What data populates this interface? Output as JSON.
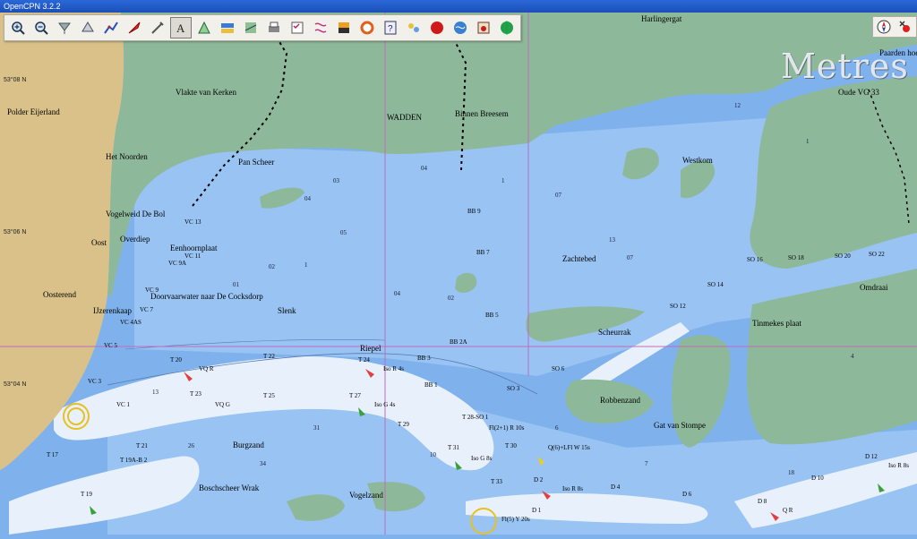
{
  "window": {
    "title": "OpenCPN 3.2.2"
  },
  "toolbar": {
    "buttons": [
      {
        "icon": "zoom-in-icon"
      },
      {
        "icon": "zoom-out-icon"
      },
      {
        "icon": "scale-in-icon"
      },
      {
        "icon": "scale-out-icon"
      },
      {
        "icon": "route-icon"
      },
      {
        "icon": "auto-follow-icon"
      },
      {
        "icon": "settings-icon"
      },
      {
        "icon": "text-icon",
        "active": true
      },
      {
        "icon": "ais-icon"
      },
      {
        "icon": "quilt-icon"
      },
      {
        "icon": "chart-panel-icon"
      },
      {
        "icon": "print-icon"
      },
      {
        "icon": "route-manager-icon"
      },
      {
        "icon": "track-icon"
      },
      {
        "icon": "color-scheme-icon"
      },
      {
        "icon": "mob-icon"
      },
      {
        "icon": "help-icon"
      },
      {
        "icon": "tides-icon"
      },
      {
        "icon": "record-icon"
      },
      {
        "icon": "world-icon"
      },
      {
        "icon": "chart-download-icon"
      },
      {
        "icon": "globe-icon"
      }
    ]
  },
  "overlay": {
    "units": "Metres"
  },
  "latitudes": [
    "53°08 N",
    "53°06 N",
    "53°04 N"
  ],
  "places": [
    {
      "text": "Harlingergat"
    },
    {
      "text": "Polder Eijerland"
    },
    {
      "text": "Vlakte van Kerken"
    },
    {
      "text": "WADDEN"
    },
    {
      "text": "Binnen Breesem"
    },
    {
      "text": "Het Noorden"
    },
    {
      "text": "Pan Scheer"
    },
    {
      "text": "Vogelweid De Bol"
    },
    {
      "text": "Oost"
    },
    {
      "text": "Overdiep"
    },
    {
      "text": "Eenhoornplaat"
    },
    {
      "text": "Oosterend"
    },
    {
      "text": "IJzerenkaap"
    },
    {
      "text": "Slenk"
    },
    {
      "text": "Zachtebed"
    },
    {
      "text": "Westkom"
    },
    {
      "text": "Oude VG 33"
    },
    {
      "text": "Paarden hoek"
    },
    {
      "text": "Omdraai"
    },
    {
      "text": "Tinmekes plaat"
    },
    {
      "text": "Scheurrak"
    },
    {
      "text": "Robbenzand"
    },
    {
      "text": "Gat van Stompe"
    },
    {
      "text": "Burgzand"
    },
    {
      "text": "Boschscheer Wrak"
    },
    {
      "text": "Vogelzand"
    },
    {
      "text": "Riepel"
    },
    {
      "text": "Doorvaarwater naar De Cocksdorp"
    }
  ],
  "buoys": [
    {
      "text": "VC 13"
    },
    {
      "text": "VC 11"
    },
    {
      "text": "VC 9A"
    },
    {
      "text": "VC 9"
    },
    {
      "text": "VC 7"
    },
    {
      "text": "VC 5"
    },
    {
      "text": "VC 3"
    },
    {
      "text": "VC 1"
    },
    {
      "text": "VC 4AS"
    },
    {
      "text": "BB 9"
    },
    {
      "text": "BB 7"
    },
    {
      "text": "BB 5"
    },
    {
      "text": "BB 3"
    },
    {
      "text": "BB 1"
    },
    {
      "text": "BB 2A"
    },
    {
      "text": "T 20"
    },
    {
      "text": "T 22"
    },
    {
      "text": "T 24"
    },
    {
      "text": "T 23"
    },
    {
      "text": "T 25"
    },
    {
      "text": "T 27"
    },
    {
      "text": "T 29"
    },
    {
      "text": "T 28-SO 1"
    },
    {
      "text": "T 31"
    },
    {
      "text": "T 30"
    },
    {
      "text": "T 33"
    },
    {
      "text": "T 21"
    },
    {
      "text": "T 19A-B 2"
    },
    {
      "text": "T 19"
    },
    {
      "text": "T 17"
    },
    {
      "text": "SO 16"
    },
    {
      "text": "SO 18"
    },
    {
      "text": "SO 20"
    },
    {
      "text": "SO 22"
    },
    {
      "text": "SO 14"
    },
    {
      "text": "SO 12"
    },
    {
      "text": "SO 6"
    },
    {
      "text": "SO 3"
    },
    {
      "text": "D 1"
    },
    {
      "text": "D 2"
    },
    {
      "text": "D 4"
    },
    {
      "text": "D 6"
    },
    {
      "text": "D 8"
    },
    {
      "text": "D 10"
    },
    {
      "text": "D 12"
    },
    {
      "text": "Iso R 4s"
    },
    {
      "text": "Iso G 4s"
    },
    {
      "text": "VQ G"
    },
    {
      "text": "VQ R"
    },
    {
      "text": "Fl(2+1) R 10s"
    },
    {
      "text": "Iso G 8s"
    },
    {
      "text": "Iso R 8s"
    },
    {
      "text": "Q(6)+LFl W 15s"
    },
    {
      "text": "Fl(5) Y 20s"
    },
    {
      "text": "Q R"
    },
    {
      "text": "Iso R 8s"
    }
  ]
}
